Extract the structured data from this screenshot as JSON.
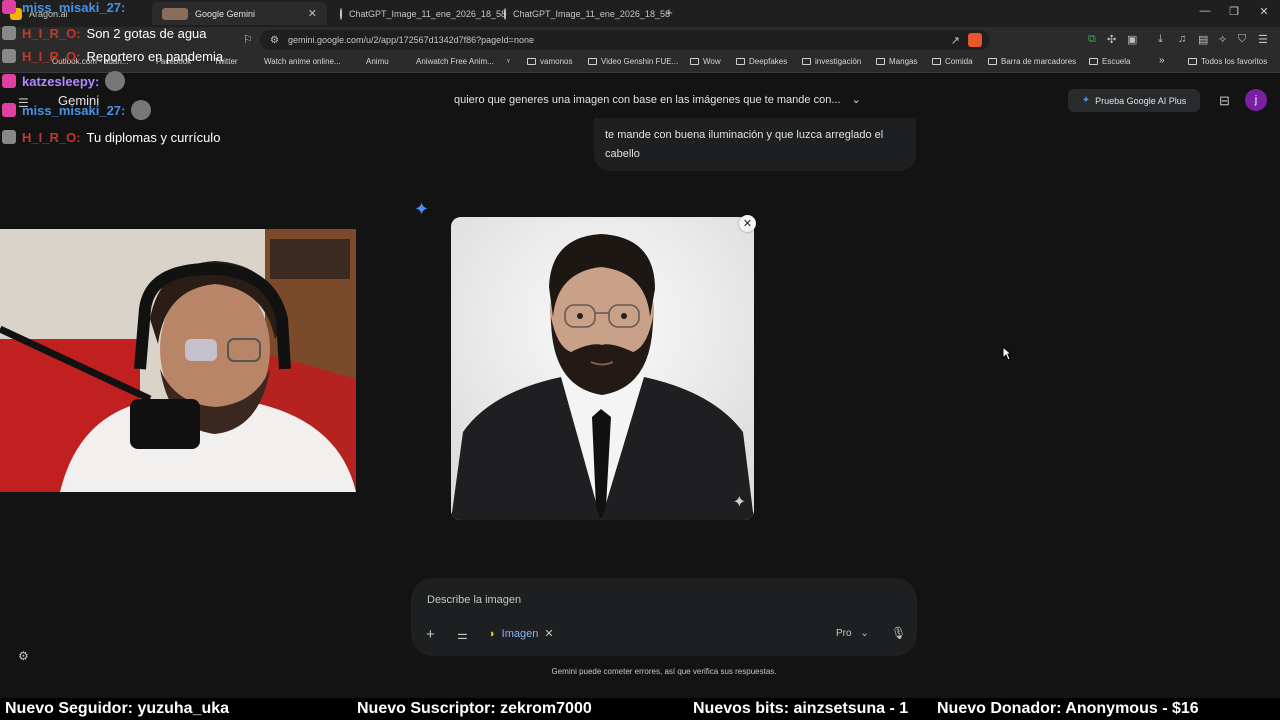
{
  "browser": {
    "tabs": [
      {
        "label": "Aragon.ai",
        "favicon_color": "#f4b400"
      },
      {
        "label": "Google Gemini",
        "favicon_color": "#8a6d5b",
        "active": true
      },
      {
        "label": "ChatGPT_Image_11_ene_2026_18_58",
        "favicon_color": "#ffffff"
      },
      {
        "label": "ChatGPT_Image_11_ene_2026_18_58",
        "favicon_color": "#ffffff"
      }
    ],
    "new_tab_glyph": "+",
    "url": "gemini.google.com/u/2/app/172567d1342d7f86?pageId=none",
    "bookmarks": [
      "Outlook.com - adan...",
      "Facebook",
      "Twitter",
      "Watch anime online...",
      "Animu",
      "Aniwatch Free Anim...",
      "",
      "vamonos",
      "Video Genshin FUE...",
      "Wow",
      "Deepfakes",
      "investigación",
      "Mangas",
      "Comida",
      "Barra de marcadores",
      "Escuela"
    ],
    "bookmarks_more": "»",
    "all_bookmarks": "Todos los favoritos"
  },
  "overlay_chat": [
    {
      "user": "miss_misaki_27:",
      "msg": "",
      "color": "#4a90e2",
      "badge": "#e040a0"
    },
    {
      "user": "H_I_R_O:",
      "msg": "Son 2 gotas de agua",
      "color": "#c0392b",
      "badge": "#888888"
    },
    {
      "user": "H_I_R_O:",
      "msg": "Reportero en pandemia",
      "color": "#c0392b",
      "badge": "#888888"
    },
    {
      "user": "katzesleepy:",
      "msg": "",
      "color": "#b388ff",
      "badge": "#e040a0"
    },
    {
      "user": "miss_misaki_27:",
      "msg": "",
      "color": "#4a90e2",
      "badge": "#e040a0"
    },
    {
      "user": "H_I_R_O:",
      "msg": "Tu diplomas y currículo",
      "color": "#c0392b",
      "badge": "#888888"
    }
  ],
  "gemini": {
    "app_title": "Gemini",
    "conversation_title": "quiero que generes una imagen con base en las imágenes que te mande con...",
    "ai_plus_label": "Prueba Google AI Plus",
    "avatar_letter": "j",
    "user_message": "te mande con buena iluminación y que luzca arreglado el cabello",
    "prompt_placeholder": "Describe la imagen",
    "tool_chip_label": "Imagen",
    "model_label": "Pro",
    "disclaimer": "Gemini puede cometer errores, así que verifica sus respuestas."
  },
  "ticker": {
    "follower": "Nuevo Seguidor: yuzuha_uka",
    "subscriber": "Nuevo Suscriptor: zekrom7000",
    "bits": "Nuevos bits: ainzsetsuna - 1",
    "donor": "Nuevo Donador: Anonymous - $16"
  },
  "colors": {
    "accent": "#4a8ff0",
    "bg": "#131314",
    "surface": "#1e1f20"
  }
}
